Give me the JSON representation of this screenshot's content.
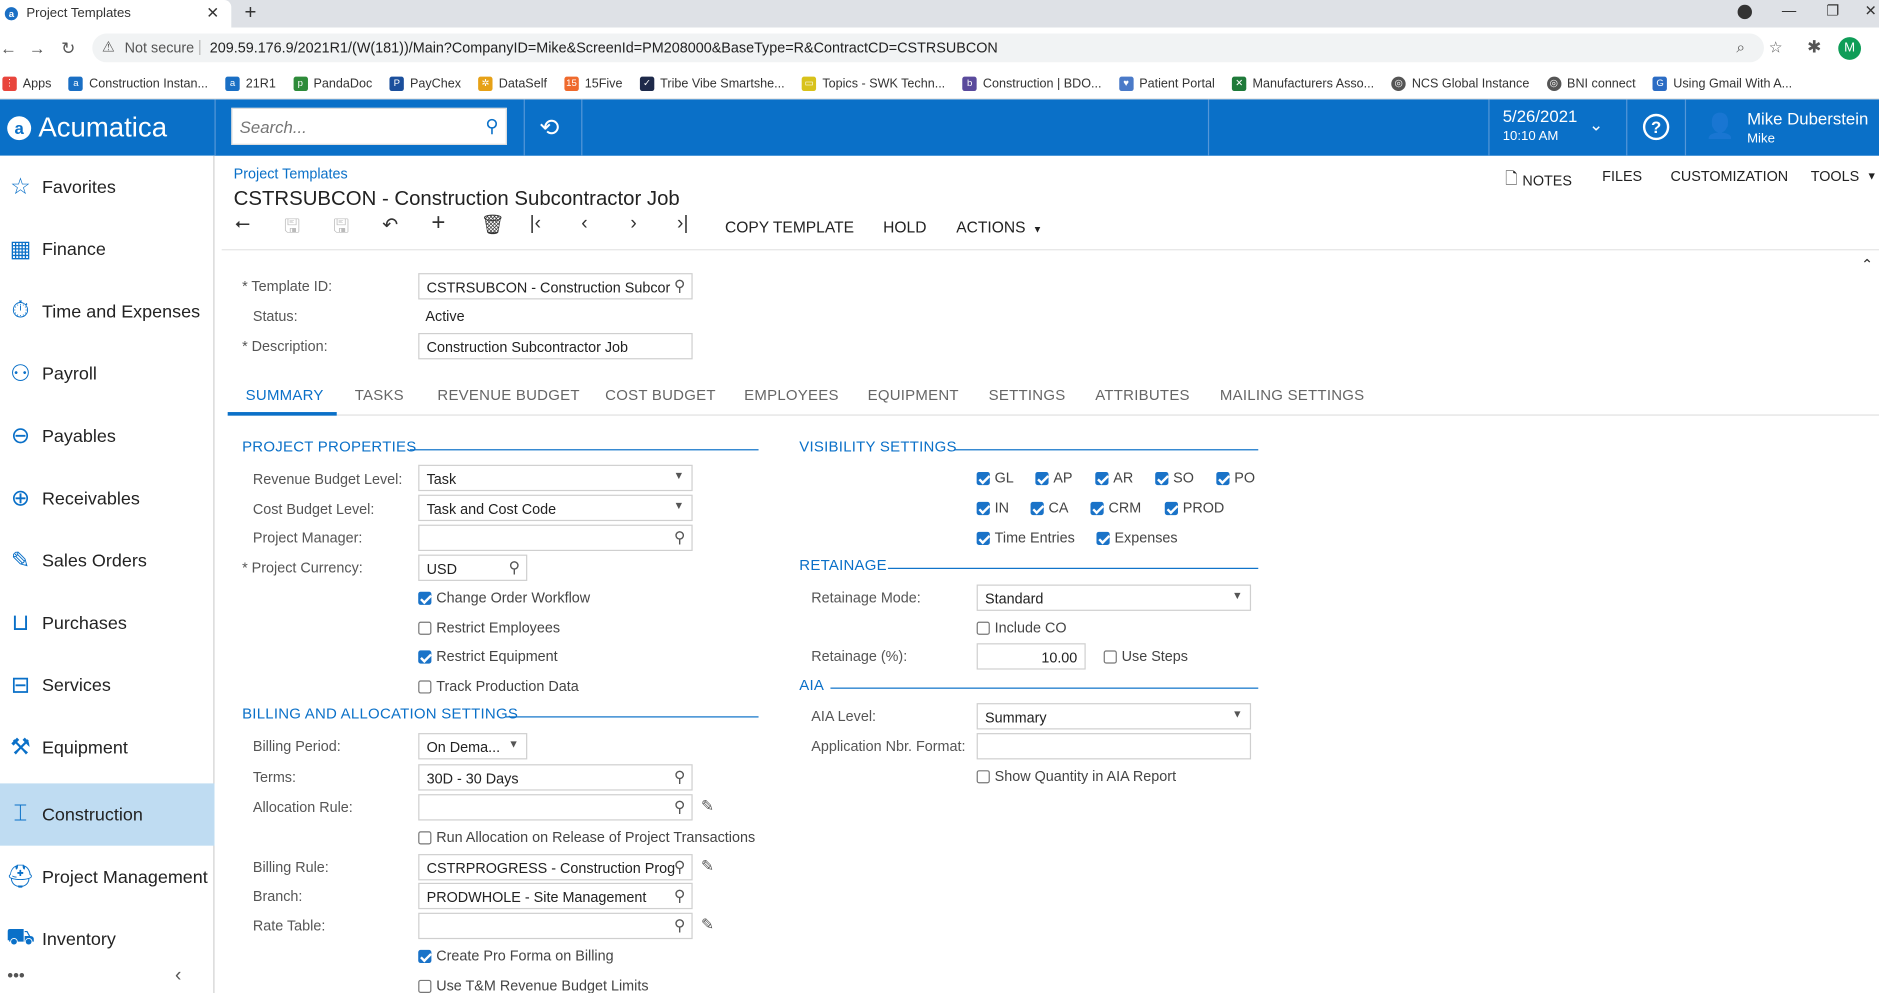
{
  "browser": {
    "tab_title": "Project Templates",
    "not_secure": "Not secure",
    "url": "209.59.176.9/2021R1/(W(181))/Main?CompanyID=Mike&ScreenId=PM208000&BaseType=R&ContractCD=CSTRSUBCON",
    "profile_initial": "M",
    "bookmarks": [
      "Apps",
      "Construction Instan...",
      "21R1",
      "PandaDoc",
      "PayChex",
      "DataSelf",
      "15Five",
      "Tribe Vibe Smartshe...",
      "Topics - SWK Techn...",
      "Construction | BDO...",
      "Patient Portal",
      "Manufacturers Asso...",
      "NCS Global Instance",
      "BNI connect",
      "Using Gmail With A..."
    ]
  },
  "header": {
    "logo": "Acumatica",
    "search_placeholder": "Search...",
    "date": "5/26/2021",
    "time": "10:10 AM",
    "user_name": "Mike Duberstein",
    "company": "Mike"
  },
  "sidebar": {
    "items": [
      "Favorites",
      "Finance",
      "Time and Expenses",
      "Payroll",
      "Payables",
      "Receivables",
      "Sales Orders",
      "Purchases",
      "Services",
      "Equipment",
      "Construction",
      "Project Management",
      "Inventory"
    ],
    "active": "Construction"
  },
  "page": {
    "breadcrumb": "Project Templates",
    "title": "CSTRSUBCON - Construction Subcontractor Job",
    "top_links": {
      "notes": "NOTES",
      "files": "FILES",
      "customization": "CUSTOMIZATION",
      "tools": "TOOLS"
    },
    "toolbar": {
      "copy_template": "COPY TEMPLATE",
      "hold": "HOLD",
      "actions": "ACTIONS"
    }
  },
  "form": {
    "template_id_label": "Template ID:",
    "template_id": "CSTRSUBCON - Construction Subcor",
    "status_label": "Status:",
    "status": "Active",
    "description_label": "Description:",
    "description": "Construction Subcontractor Job"
  },
  "tabs": [
    "SUMMARY",
    "TASKS",
    "REVENUE BUDGET",
    "COST BUDGET",
    "EMPLOYEES",
    "EQUIPMENT",
    "SETTINGS",
    "ATTRIBUTES",
    "MAILING SETTINGS"
  ],
  "project_properties": {
    "heading": "PROJECT PROPERTIES",
    "revenue_budget_level_label": "Revenue Budget Level:",
    "revenue_budget_level": "Task",
    "cost_budget_level_label": "Cost Budget Level:",
    "cost_budget_level": "Task and Cost Code",
    "project_manager_label": "Project Manager:",
    "project_manager": "",
    "project_currency_label": "Project Currency:",
    "project_currency": "USD",
    "change_order_workflow": "Change Order Workflow",
    "restrict_employees": "Restrict Employees",
    "restrict_equipment": "Restrict Equipment",
    "track_production_data": "Track Production Data"
  },
  "billing": {
    "heading": "BILLING AND ALLOCATION SETTINGS",
    "billing_period_label": "Billing Period:",
    "billing_period": "On Dema...",
    "terms_label": "Terms:",
    "terms": "30D - 30 Days",
    "allocation_rule_label": "Allocation Rule:",
    "allocation_rule": "",
    "run_allocation": "Run Allocation on Release of Project Transactions",
    "billing_rule_label": "Billing Rule:",
    "billing_rule": "CSTRPROGRESS - Construction Prog",
    "branch_label": "Branch:",
    "branch": "PRODWHOLE - Site Management",
    "rate_table_label": "Rate Table:",
    "rate_table": "",
    "create_pro_forma": "Create Pro Forma on Billing",
    "use_tm_limits": "Use T&M Revenue Budget Limits"
  },
  "visibility": {
    "heading": "VISIBILITY SETTINGS",
    "row1": [
      "GL",
      "AP",
      "AR",
      "SO",
      "PO"
    ],
    "row2": [
      "IN",
      "CA",
      "CRM",
      "PROD"
    ],
    "row3": [
      "Time Entries",
      "Expenses"
    ]
  },
  "retainage": {
    "heading": "RETAINAGE",
    "mode_label": "Retainage Mode:",
    "mode": "Standard",
    "include_co": "Include CO",
    "pct_label": "Retainage (%):",
    "pct": "10.00",
    "use_steps": "Use Steps"
  },
  "aia": {
    "heading": "AIA",
    "level_label": "AIA Level:",
    "level": "Summary",
    "nbr_format_label": "Application Nbr. Format:",
    "nbr_format": "",
    "show_qty": "Show Quantity in AIA Report"
  },
  "colors": {
    "brand": "#0a70c8",
    "sidebar_active": "#bfdcf2"
  }
}
